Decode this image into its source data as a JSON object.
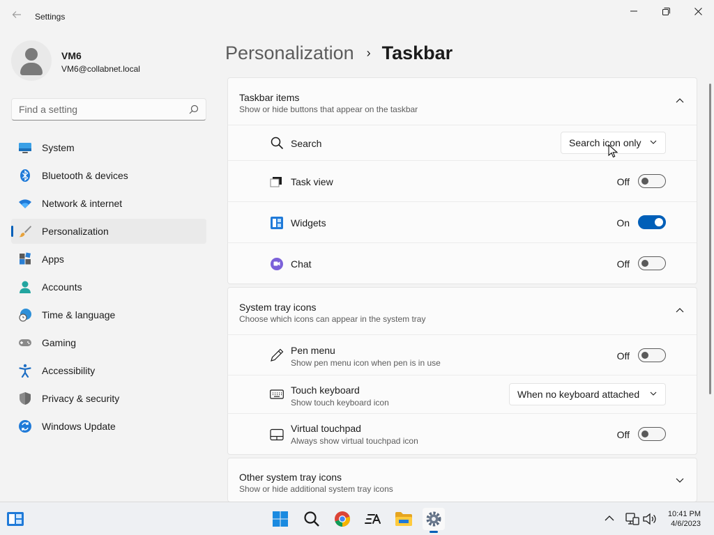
{
  "window": {
    "title": "Settings"
  },
  "user": {
    "name": "VM6",
    "email": "VM6@collabnet.local"
  },
  "search": {
    "placeholder": "Find a setting"
  },
  "sidebar": {
    "items": [
      {
        "label": "System",
        "icon": "system-icon"
      },
      {
        "label": "Bluetooth & devices",
        "icon": "bluetooth-icon"
      },
      {
        "label": "Network & internet",
        "icon": "wifi-icon"
      },
      {
        "label": "Personalization",
        "icon": "brush-icon",
        "active": true
      },
      {
        "label": "Apps",
        "icon": "apps-icon"
      },
      {
        "label": "Accounts",
        "icon": "accounts-icon"
      },
      {
        "label": "Time & language",
        "icon": "globe-clock-icon"
      },
      {
        "label": "Gaming",
        "icon": "gamepad-icon"
      },
      {
        "label": "Accessibility",
        "icon": "accessibility-icon"
      },
      {
        "label": "Privacy & security",
        "icon": "shield-icon"
      },
      {
        "label": "Windows Update",
        "icon": "update-icon"
      }
    ]
  },
  "breadcrumb": {
    "parent": "Personalization",
    "separator": "›",
    "current": "Taskbar"
  },
  "taskbar_items": {
    "title": "Taskbar items",
    "subtitle": "Show or hide buttons that appear on the taskbar",
    "search": {
      "label": "Search",
      "value": "Search icon only"
    },
    "task_view": {
      "label": "Task view",
      "state": "Off"
    },
    "widgets": {
      "label": "Widgets",
      "state": "On"
    },
    "chat": {
      "label": "Chat",
      "state": "Off"
    }
  },
  "system_tray": {
    "title": "System tray icons",
    "subtitle": "Choose which icons can appear in the system tray",
    "pen_menu": {
      "label": "Pen menu",
      "sub": "Show pen menu icon when pen is in use",
      "state": "Off"
    },
    "touch_keyboard": {
      "label": "Touch keyboard",
      "sub": "Show touch keyboard icon",
      "value": "When no keyboard attached"
    },
    "virtual_touchpad": {
      "label": "Virtual touchpad",
      "sub": "Always show virtual touchpad icon",
      "state": "Off"
    }
  },
  "other_tray": {
    "title": "Other system tray icons",
    "subtitle": "Show or hide additional system tray icons"
  },
  "clock": {
    "time": "10:41 PM",
    "date": "4/6/2023"
  },
  "colors": {
    "accent": "#005fb8",
    "background": "#f3f3f3",
    "card": "#fbfbfb"
  }
}
